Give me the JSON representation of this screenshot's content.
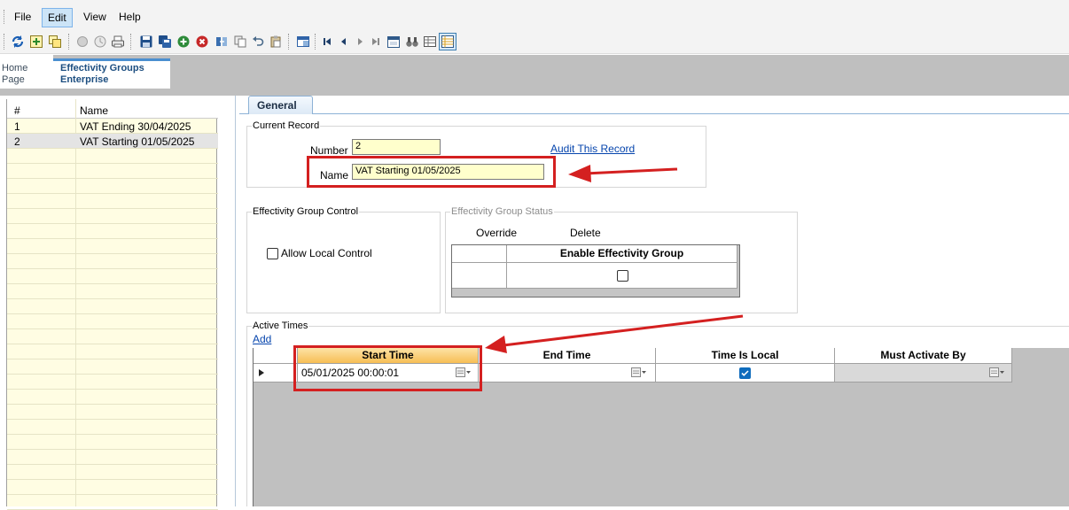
{
  "menu": {
    "items": [
      "File",
      "Edit",
      "View",
      "Help"
    ],
    "active": "Edit"
  },
  "toolbar": {
    "icons": [
      "refresh-icon",
      "new-record-icon",
      "copy-record-icon",
      "disabled-circle-icon",
      "disabled-clock-icon",
      "print-icon",
      "save-icon",
      "save-all-icon",
      "add-icon",
      "delete-icon",
      "export-icon",
      "copy-icon",
      "undo-icon",
      "paste-icon",
      "layout-icon",
      "first-record-icon",
      "previous-record-icon",
      "next-record-icon",
      "last-record-icon",
      "calendar-icon",
      "binoculars-icon",
      "grid-view-icon",
      "form-view-icon"
    ]
  },
  "doc_tabs": {
    "home_line1": "Home",
    "home_line2": "Page",
    "groups_line1": "Effectivity Groups",
    "groups_line2": "Enterprise"
  },
  "list": {
    "col_index": "#",
    "col_name": "Name",
    "rows": [
      {
        "index": "1",
        "name": "VAT Ending 30/04/2025"
      },
      {
        "index": "2",
        "name": "VAT Starting 01/05/2025"
      }
    ],
    "selected_index": 1
  },
  "form": {
    "tab_label": "General",
    "current_record": {
      "legend": "Current Record",
      "number_label": "Number",
      "number_value": "2",
      "name_label": "Name",
      "name_value": "VAT Starting 01/05/2025",
      "audit_link": "Audit This Record"
    },
    "group_control": {
      "legend": "Effectivity Group Control",
      "allow_local_label": "Allow Local Control",
      "allow_local_checked": false
    },
    "group_status": {
      "legend": "Effectivity Group Status",
      "override_label": "Override",
      "delete_label": "Delete",
      "enable_header": "Enable Effectivity Group",
      "enable_checked": false
    },
    "active_times": {
      "legend": "Active Times",
      "add_link": "Add",
      "columns": [
        "Start Time",
        "End Time",
        "Time Is Local",
        "Must Activate By"
      ],
      "rows": [
        {
          "start_time": "05/01/2025  00:00:01",
          "end_time": "",
          "time_is_local": true,
          "must_activate_by": ""
        }
      ]
    }
  },
  "colors": {
    "highlight_red": "#d42020",
    "list_background": "#fffde3",
    "field_background": "#ffffcc",
    "active_header": "#f7be55"
  }
}
